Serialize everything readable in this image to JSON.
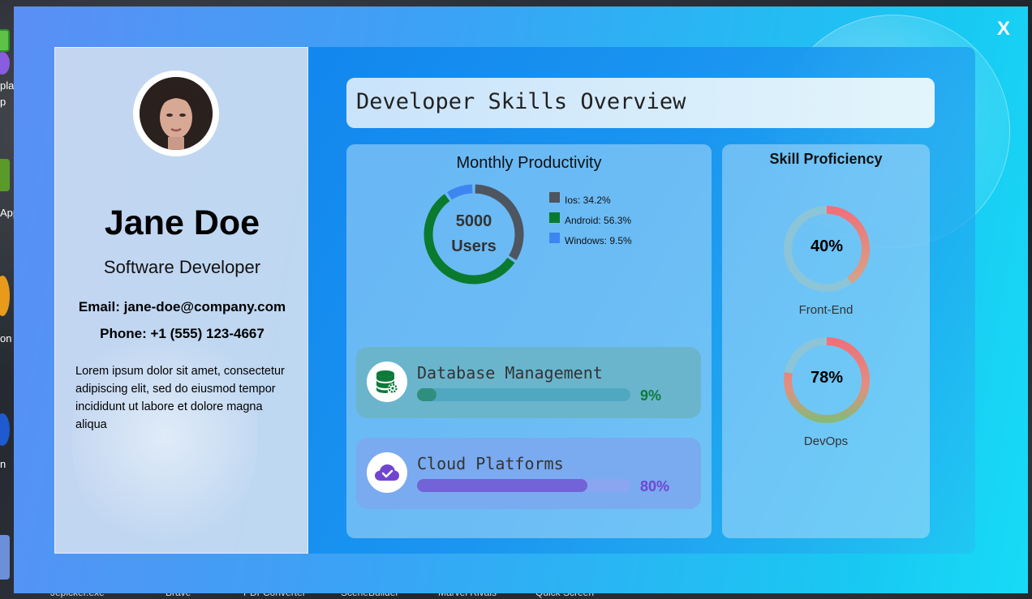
{
  "window": {
    "close_label": "X"
  },
  "desktop": {
    "left_labels": [
      "plat",
      "p",
      "App",
      "on",
      "n"
    ],
    "taskbar_labels": [
      "Jepicker.exe",
      "Brave",
      "PDFConverter",
      "SceneBuilder",
      "Marvel Rivals",
      "Quick Screen"
    ]
  },
  "profile": {
    "name": "Jane Doe",
    "role": "Software Developer",
    "email": "Email: jane-doe@company.com",
    "phone": "Phone: +1 (555) 123-4667",
    "bio": "Lorem ipsum dolor sit amet, consectetur adipiscing elit, sed do eiusmod tempor incididunt ut labore et dolore magna aliqua"
  },
  "dashboard": {
    "title": "Developer Skills Overview",
    "productivity": {
      "title": "Monthly Productivity",
      "center_value": "5000",
      "center_unit": "Users",
      "legend": [
        {
          "label": "Ios: 34.2%",
          "value": 34.2,
          "color": "#4d5560"
        },
        {
          "label": "Android: 56.3%",
          "value": 56.3,
          "color": "#0a7a2e"
        },
        {
          "label": "Windows: 9.5%",
          "value": 9.5,
          "color": "#3d86f2"
        }
      ]
    },
    "skills": [
      {
        "label": "Database Management",
        "percent_text": "9%",
        "value": 0.09,
        "icon": "database-icon",
        "accent": "#0d7a3a",
        "track": "#4fa8c0",
        "fill": "#2f8f7f",
        "card": "#6ab5cc"
      },
      {
        "label": "Cloud Platforms",
        "percent_text": "80%",
        "value": 0.8,
        "icon": "cloud-check-icon",
        "accent": "#7046d0",
        "track": "#8aa6f0",
        "fill": "#7263d8",
        "card": "#7aaaf0"
      }
    ],
    "proficiency": {
      "title": "Skill Proficiency",
      "rings": [
        {
          "label": "Front-End",
          "percent_text": "40%",
          "value": 0.4
        },
        {
          "label": "DevOps",
          "percent_text": "78%",
          "value": 0.78
        }
      ]
    }
  }
}
